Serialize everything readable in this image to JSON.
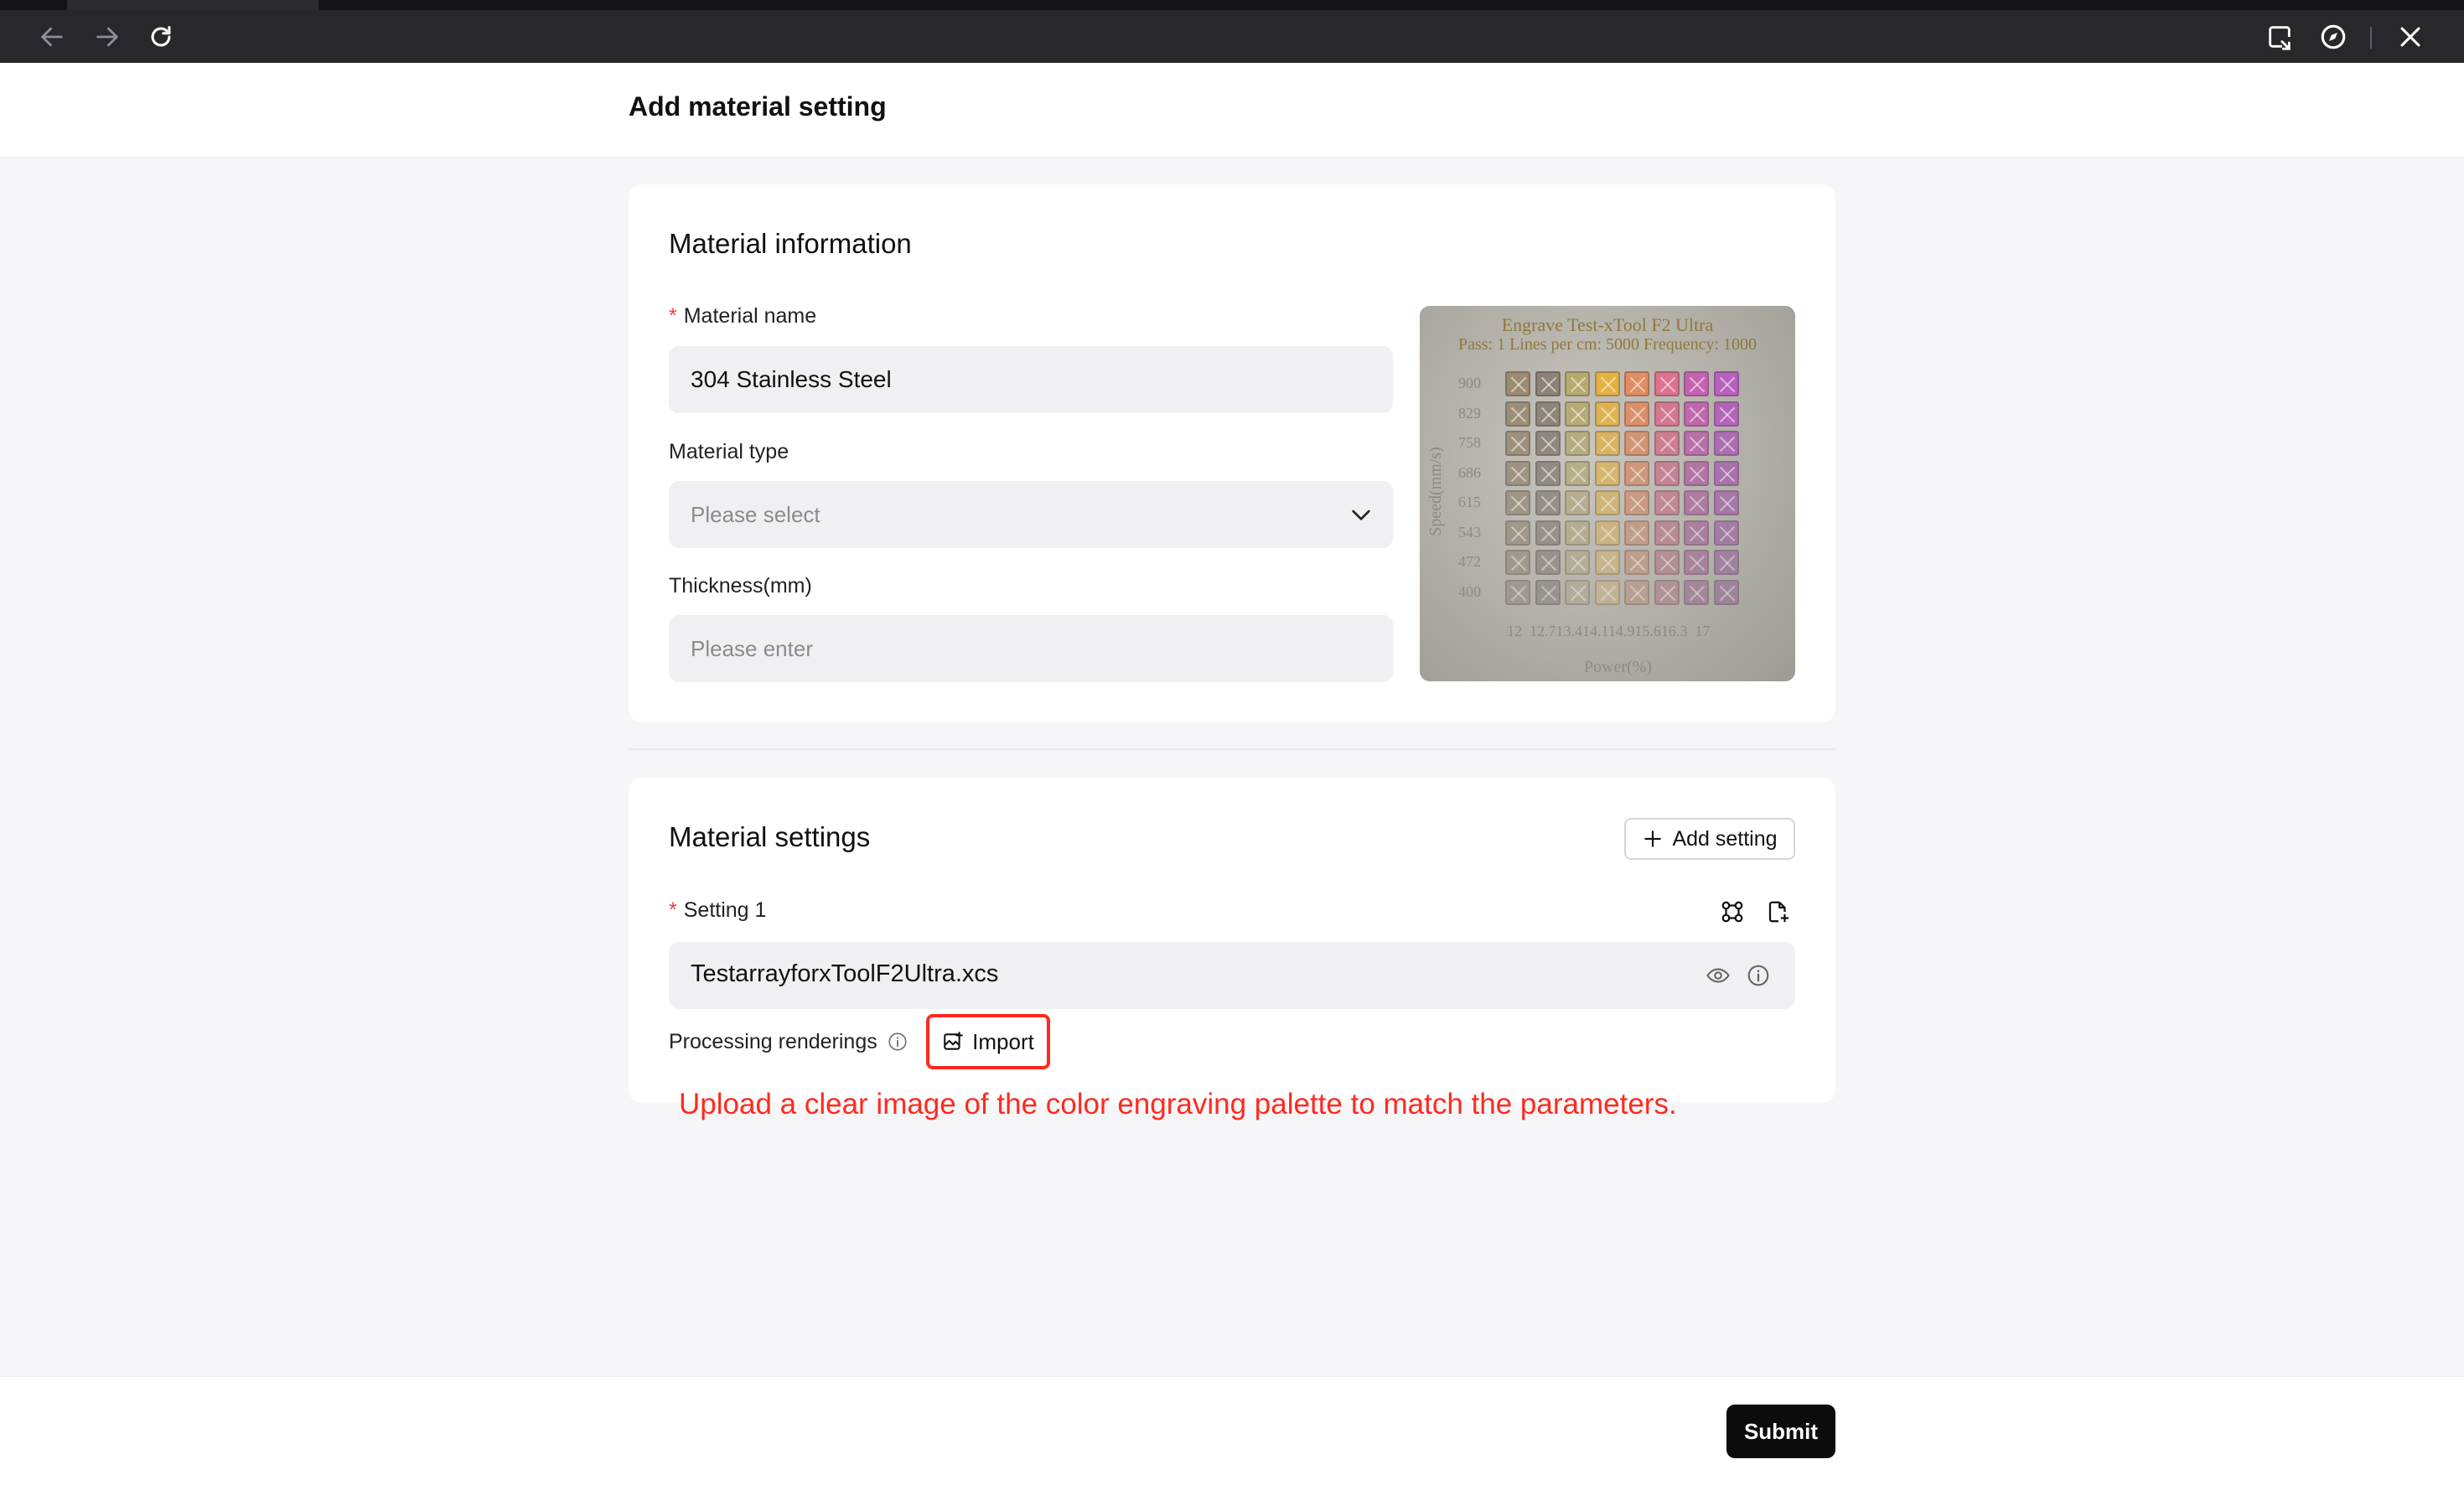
{
  "page": {
    "title": "Add material setting"
  },
  "material_info": {
    "section_title": "Material information",
    "name": {
      "label": "Material name",
      "value": "304 Stainless Steel"
    },
    "type": {
      "label": "Material type",
      "placeholder": "Please select"
    },
    "thickness": {
      "label": "Thickness(mm)",
      "placeholder": "Please enter"
    },
    "preview": {
      "title": "Engrave Test-xTool F2 Ultra",
      "subtitle": "Pass: 1 Lines per cm: 5000 Frequency: 1000",
      "speed_axis": "Speed(mm/s)",
      "power_axis": "Power(%)",
      "speed_rows": [
        "900",
        "829",
        "758",
        "686",
        "615",
        "543",
        "472",
        "400"
      ],
      "power_ticks": "12  12.713.414.114.915.616.3  17",
      "palette": [
        "#9a8a6e",
        "#8a7f72",
        "#b8a86a",
        "#e7b13a",
        "#e58a5c",
        "#df6e8e",
        "#c65eb0",
        "#b85cc0"
      ]
    }
  },
  "settings": {
    "section_title": "Material settings",
    "add_button": "Add setting",
    "setting_label": "Setting 1",
    "file_name": "TestarrayforxToolF2Ultra.xcs",
    "renderings_label": "Processing renderings",
    "import_button": "Import",
    "hint": "Upload a clear image of the color engraving palette to match the parameters."
  },
  "footer": {
    "submit": "Submit"
  },
  "icons": {
    "back": "arrow-left-icon",
    "forward": "arrow-right-icon",
    "reload": "reload-icon",
    "ext1": "document-link-icon",
    "ext2": "compass-icon",
    "close": "close-icon"
  }
}
